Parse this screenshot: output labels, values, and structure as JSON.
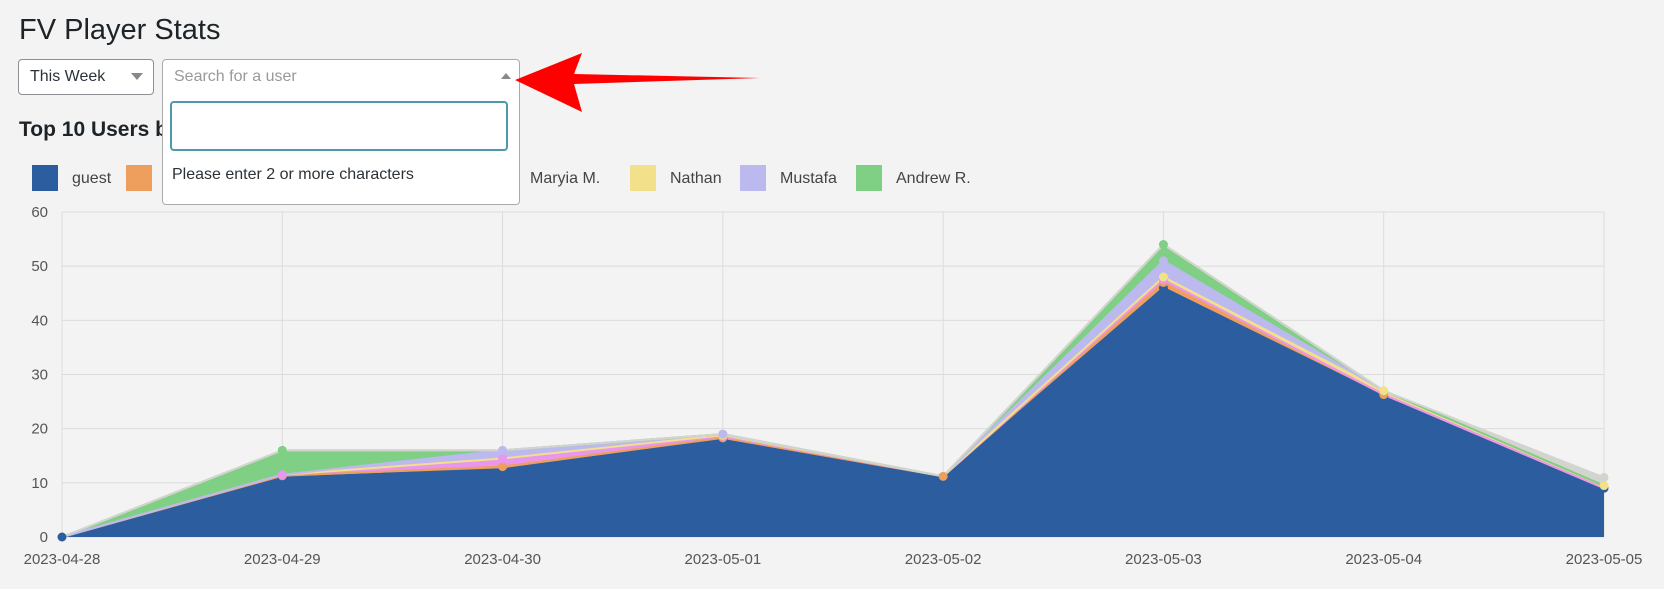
{
  "page": {
    "title": "FV Player Stats"
  },
  "filters": {
    "range_select": {
      "value": "This Week"
    },
    "user_select": {
      "placeholder": "Search for a user",
      "dropdown_search_value": "",
      "dropdown_message": "Please enter 2 or more characters"
    }
  },
  "annotation": {
    "arrow_color": "#ff0000"
  },
  "section": {
    "title": "Top 10 Users b"
  },
  "chart_data": {
    "type": "area",
    "stacked": true,
    "title": "",
    "xlabel": "",
    "ylabel": "",
    "ylim": [
      0,
      60
    ],
    "yticks": [
      "0",
      "10",
      "20",
      "30",
      "40",
      "50",
      "60"
    ],
    "x": [
      "2023-04-28",
      "2023-04-29",
      "2023-04-30",
      "2023-05-01",
      "2023-05-02",
      "2023-05-03",
      "2023-05-04",
      "2023-05-05"
    ],
    "grid": true,
    "legend": [
      {
        "name": "guest",
        "color": "#2c5d9f"
      },
      {
        "name": "",
        "color": "#ef9f5d"
      },
      {
        "name": "Maryia M.",
        "color": "#e997ee"
      },
      {
        "name": "Nathan",
        "color": "#f2e08a"
      },
      {
        "name": "Mustafa",
        "color": "#bcb9ef"
      },
      {
        "name": "Andrew R.",
        "color": "#7fcf84"
      }
    ],
    "series": [
      {
        "name": "guest",
        "color": "#2c5d9f",
        "values": [
          0,
          11,
          12.5,
          18,
          11,
          46,
          26,
          9
        ]
      },
      {
        "name": "",
        "color": "#ef9f5d",
        "values": [
          0,
          0.3,
          0.5,
          0.3,
          0.2,
          1,
          0.3,
          0
        ]
      },
      {
        "name": "Maryia M.",
        "color": "#e997ee",
        "values": [
          0,
          0.2,
          1.5,
          0.3,
          0,
          0.5,
          0,
          0
        ]
      },
      {
        "name": "Nathan",
        "color": "#f2e08a",
        "values": [
          0,
          0,
          0,
          0.2,
          0,
          0.5,
          0.7,
          0.5
        ]
      },
      {
        "name": "Mustafa",
        "color": "#bcb9ef",
        "values": [
          0,
          0,
          1.5,
          0.2,
          0,
          3,
          0,
          0
        ]
      },
      {
        "name": "Andrew R.",
        "color": "#7fcf84",
        "values": [
          0,
          4.5,
          0,
          0,
          0,
          3,
          0,
          0
        ]
      },
      {
        "name": "",
        "color": "#d4d4cf",
        "values": [
          0,
          0,
          0,
          0,
          0,
          0,
          0,
          1.5
        ]
      }
    ]
  }
}
